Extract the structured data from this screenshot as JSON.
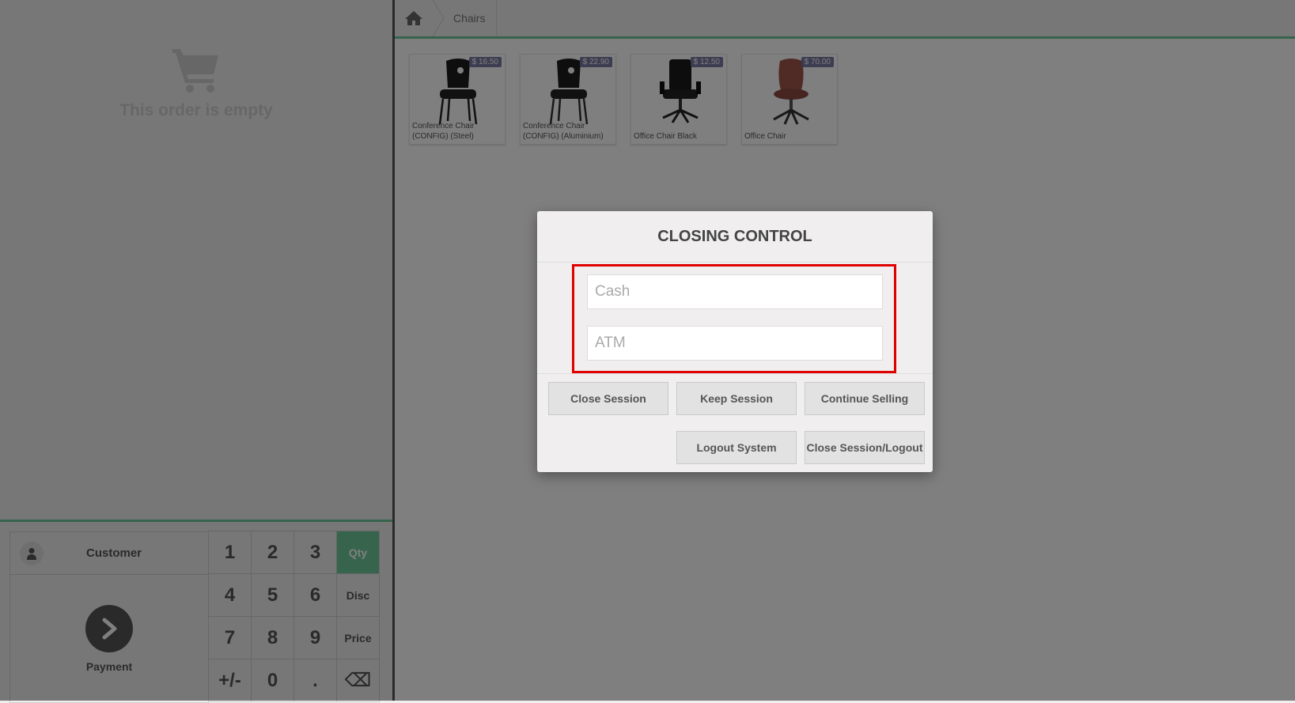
{
  "order": {
    "empty_message": "This order is empty"
  },
  "control": {
    "customer_label": "Customer",
    "payment_label": "Payment"
  },
  "numpad": {
    "keys": [
      "1",
      "2",
      "3",
      "Qty",
      "4",
      "5",
      "6",
      "Disc",
      "7",
      "8",
      "9",
      "Price",
      "+/-",
      "0",
      ".",
      "⌫"
    ],
    "selected_mode": "Qty"
  },
  "breadcrumb": {
    "home_icon": "home-icon",
    "category": "Chairs"
  },
  "products": [
    {
      "name": "Conference Chair (CONFIG) (Steel)",
      "price": "$ 16.50"
    },
    {
      "name": "Conference Chair (CONFIG) (Aluminium)",
      "price": "$ 22.90"
    },
    {
      "name": "Office Chair Black",
      "price": "$ 12.50"
    },
    {
      "name": "Office Chair",
      "price": "$ 70.00"
    }
  ],
  "modal": {
    "title": "CLOSING CONTROL",
    "cash_placeholder": "Cash",
    "atm_placeholder": "ATM",
    "buttons": {
      "close_session": "Close Session",
      "keep_session": "Keep Session",
      "continue_selling": "Continue Selling",
      "logout_system": "Logout System",
      "close_session_logout": "Close Session/Logout"
    }
  },
  "colors": {
    "accent_green": "#6ec89b",
    "highlight_red": "#e00000",
    "price_badge": "#6c6c9c"
  }
}
